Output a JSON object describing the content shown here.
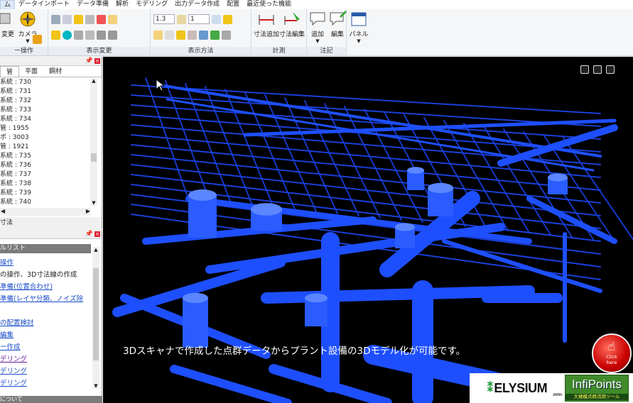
{
  "menu": {
    "items": [
      "ム",
      "データインポート",
      "データ準備",
      "解析",
      "モデリング",
      "出力データ作成",
      "配置",
      "最近使った機能"
    ]
  },
  "ribbon": {
    "change_label": "変更",
    "camera_label": "カメラ",
    "group_view_op": "ー操作",
    "group_view_change": "表示変更",
    "group_display_method": "表示方法",
    "group_measure": "計測",
    "group_annotation": "注記",
    "scale_combo": "1.3",
    "count_combo": "1",
    "dim_add": "寸法追加",
    "dim_edit": "寸法編集",
    "note_add": "追加",
    "note_edit": "編集",
    "panel": "パネル"
  },
  "left_panel_top": {
    "tabs": [
      "管",
      "平面",
      "鋼材"
    ],
    "rows": [
      "系統 : 730",
      "系統 : 731",
      "系統 : 732",
      "系統 : 733",
      "系統 : 734",
      "管 : 1955",
      "ポ : 3003",
      "管 : 1921",
      "系統 : 735",
      "系統 : 736",
      "系統 : 737",
      "系統 : 738",
      "系統 : 739",
      "系統 : 740"
    ],
    "below_tab": "寸法"
  },
  "left_panel_bottom": {
    "header": "ルリスト",
    "items": [
      {
        "text": "操作",
        "style": "link"
      },
      {
        "text": "の操作、3D寸法線の作成",
        "style": "plain"
      },
      {
        "text": "準備(位置合わせ)",
        "style": "link"
      },
      {
        "text": "準備(レイヤ分類、ノイズ除",
        "style": "link"
      },
      {
        "text": "",
        "style": "plain"
      },
      {
        "text": "の配置検討",
        "style": "link"
      },
      {
        "text": "編集",
        "style": "link"
      },
      {
        "text": "ー作成",
        "style": "link"
      },
      {
        "text": "デリング",
        "style": "visited"
      },
      {
        "text": "デリング",
        "style": "link"
      },
      {
        "text": "デリング",
        "style": "link"
      }
    ],
    "footer": "について"
  },
  "viewport": {
    "caption": "3Dスキャナで作成した点群データからプラント設備の3Dモデル化が可能です。",
    "click_button": {
      "line1": "Click",
      "line2": "here"
    },
    "logo_elysium": "ELYSIUM",
    "logo_elysium_sub": "JAPAN",
    "logo_infipoints": "InfiPoints",
    "logo_infipoints_sub": "大規模点群活用ツール"
  },
  "colors": {
    "pipe_blue": "#1e4fff",
    "viewport_bg": "#000000",
    "ribbon_bg": "#f5f6f7"
  }
}
